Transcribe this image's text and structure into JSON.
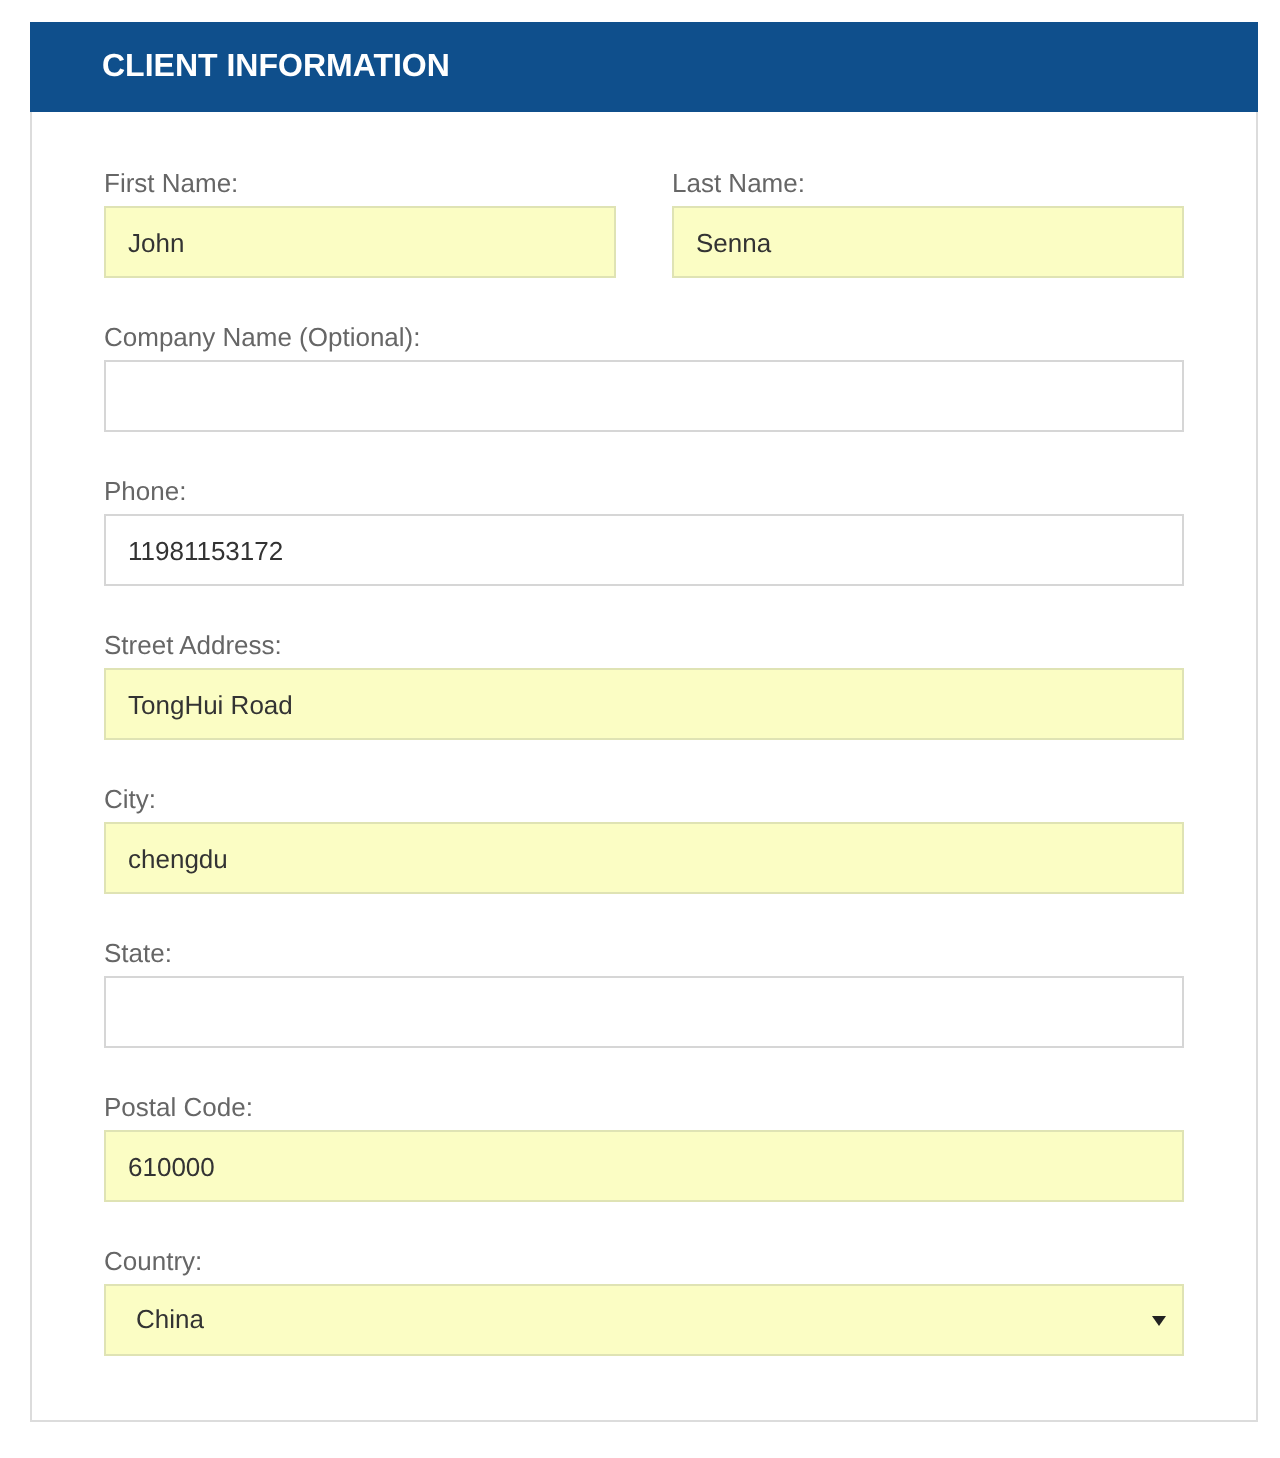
{
  "panel": {
    "title": "CLIENT INFORMATION"
  },
  "rows": [
    {
      "fields": [
        {
          "kind": "text",
          "label": "First Name:",
          "value": "John",
          "autofilled": true
        },
        {
          "kind": "text",
          "label": "Last Name:",
          "value": "Senna",
          "autofilled": true
        }
      ]
    },
    {
      "fields": [
        {
          "kind": "text",
          "label": "Company Name (Optional):",
          "autofilled": false
        }
      ]
    },
    {
      "fields": [
        {
          "kind": "text",
          "label": "Phone:",
          "value": "11981153172",
          "autofilled": false
        }
      ]
    },
    {
      "fields": [
        {
          "kind": "text",
          "label": "Street Address:",
          "value": "TongHui Road",
          "autofilled": true
        }
      ]
    },
    {
      "fields": [
        {
          "kind": "text",
          "label": "City:",
          "value": "chengdu",
          "autofilled": true
        }
      ]
    },
    {
      "fields": [
        {
          "kind": "text",
          "label": "State:",
          "autofilled": false
        }
      ]
    },
    {
      "fields": [
        {
          "kind": "text",
          "label": "Postal Code:",
          "value": "610000",
          "autofilled": true
        }
      ]
    },
    {
      "fields": [
        {
          "kind": "select",
          "label": "Country:",
          "value": "China",
          "autofilled": true
        }
      ]
    }
  ]
}
